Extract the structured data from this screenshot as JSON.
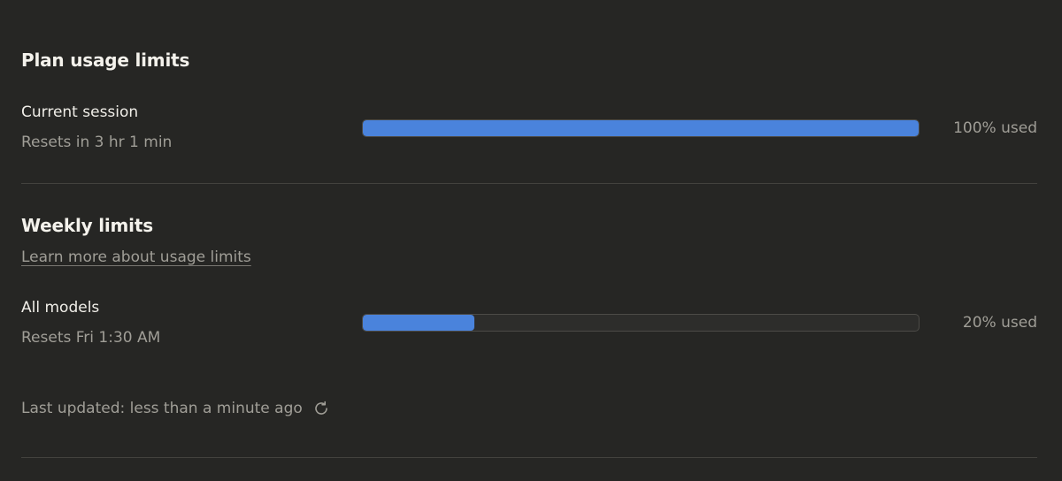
{
  "plan": {
    "title": "Plan usage limits",
    "current_session": {
      "label": "Current session",
      "reset": "Resets in 3 hr 1 min",
      "percent": 100,
      "percent_label": "100% used"
    }
  },
  "weekly": {
    "title": "Weekly limits",
    "learn_more": "Learn more about usage limits",
    "all_models": {
      "label": "All models",
      "reset": "Resets Fri 1:30 AM",
      "percent": 20,
      "percent_label": "20% used"
    }
  },
  "footer": {
    "last_updated": "Last updated: less than a minute ago",
    "refresh_icon": "refresh-icon"
  },
  "colors": {
    "background": "#262624",
    "bar_fill": "#4a83dc",
    "bar_track": "#2d2d2b"
  }
}
